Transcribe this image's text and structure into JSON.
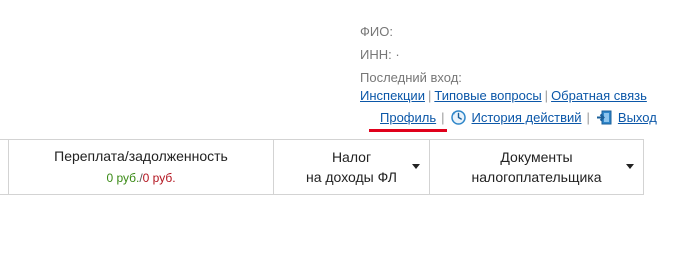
{
  "user_info": {
    "fio_label": "ФИО:",
    "inn_label": "ИНН: ·",
    "last_login_label": "Последний вход:"
  },
  "top_links": {
    "inspections": "Инспекции",
    "faq": "Типовые вопросы",
    "feedback": "Обратная связь",
    "separator": "|"
  },
  "account_links": {
    "profile": "Профиль",
    "history": "История действий",
    "logout": "Выход",
    "history_icon": "history-clock-icon",
    "logout_icon": "exit-door-icon",
    "active_indicator_color": "#e0001b"
  },
  "nav": {
    "balance": {
      "title": "Переплата/задолженность",
      "overpayment": "0 руб.",
      "divider": "/",
      "debt": "0 руб.",
      "overpayment_color": "#3a8a15",
      "debt_color": "#b3141f"
    },
    "income_tax": {
      "line1": "Налог",
      "line2": "на доходы ФЛ"
    },
    "documents": {
      "line1": "Документы",
      "line2": "налогоплательщика"
    }
  }
}
